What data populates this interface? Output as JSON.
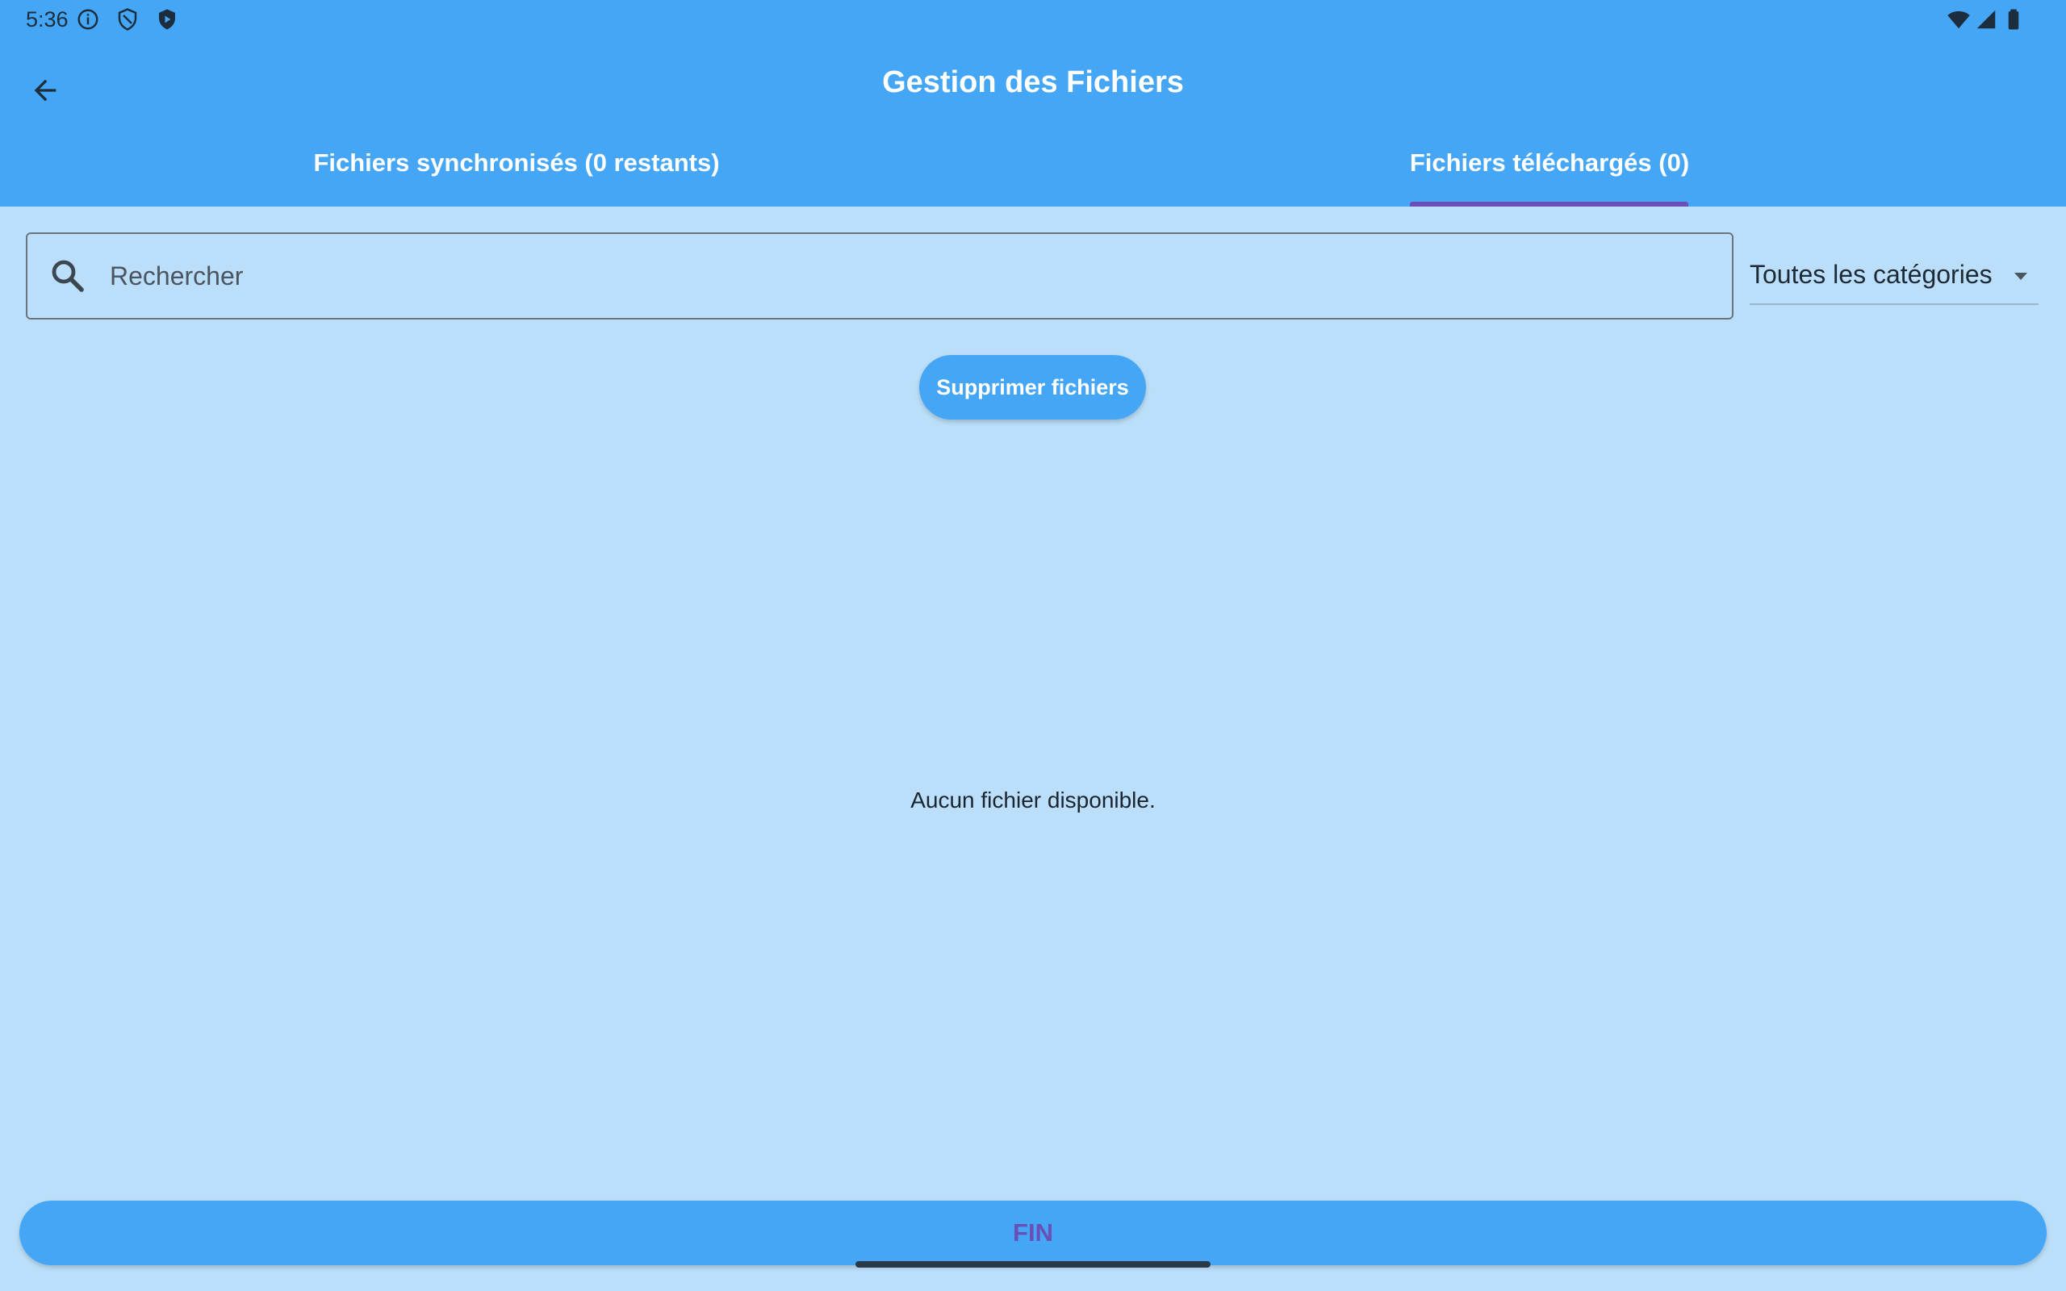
{
  "status_bar": {
    "time": "5:36",
    "left_icons": [
      "info-icon",
      "shield-outline-icon",
      "shield-play-icon"
    ],
    "right_icons": [
      "wifi-icon",
      "signal-icon",
      "battery-icon"
    ]
  },
  "app_bar": {
    "title": "Gestion des Fichiers",
    "back_icon": "arrow-back-icon",
    "tabs": [
      {
        "label": "Fichiers synchronisés (0 restants)",
        "selected": false
      },
      {
        "label": "Fichiers téléchargés (0)",
        "selected": true
      }
    ],
    "indicator_color": "#6a4fb6"
  },
  "search": {
    "placeholder": "Rechercher",
    "value": "",
    "icon": "search-icon"
  },
  "category_filter": {
    "selected": "Toutes les catégories",
    "icon": "caret-down-icon"
  },
  "actions": {
    "delete_label": "Supprimer fichiers",
    "finish_label": "FIN"
  },
  "empty_state": {
    "message": "Aucun fichier disponible."
  },
  "colors": {
    "primary": "#44a6f5",
    "background": "#bbdffa",
    "accent": "#6a4fb6"
  }
}
